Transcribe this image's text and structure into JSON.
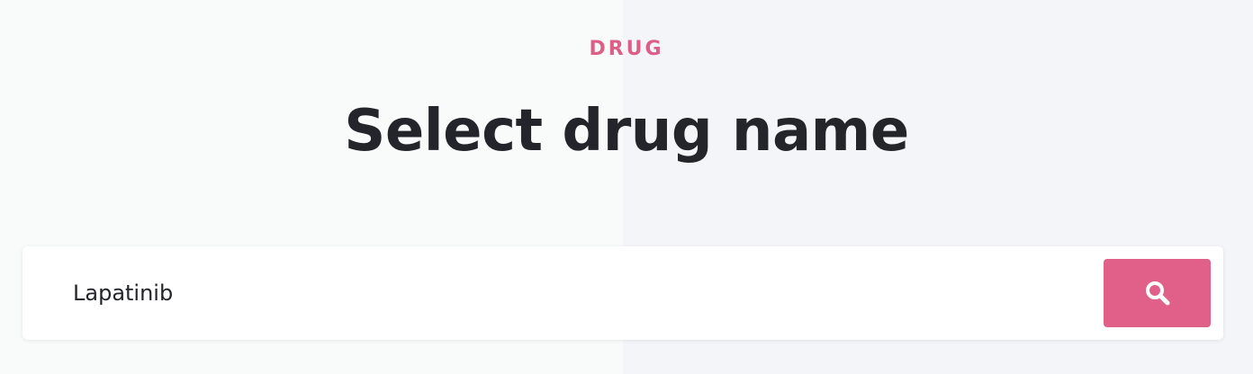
{
  "header": {
    "eyebrow": "DRUG",
    "title": "Select drug name"
  },
  "search": {
    "value": "Lapatinib",
    "button_icon": "search-icon"
  },
  "colors": {
    "accent": "#e06089",
    "title_text": "#23252b",
    "background_left": "#f9fbfb",
    "background_right": "#f4f5f8"
  }
}
